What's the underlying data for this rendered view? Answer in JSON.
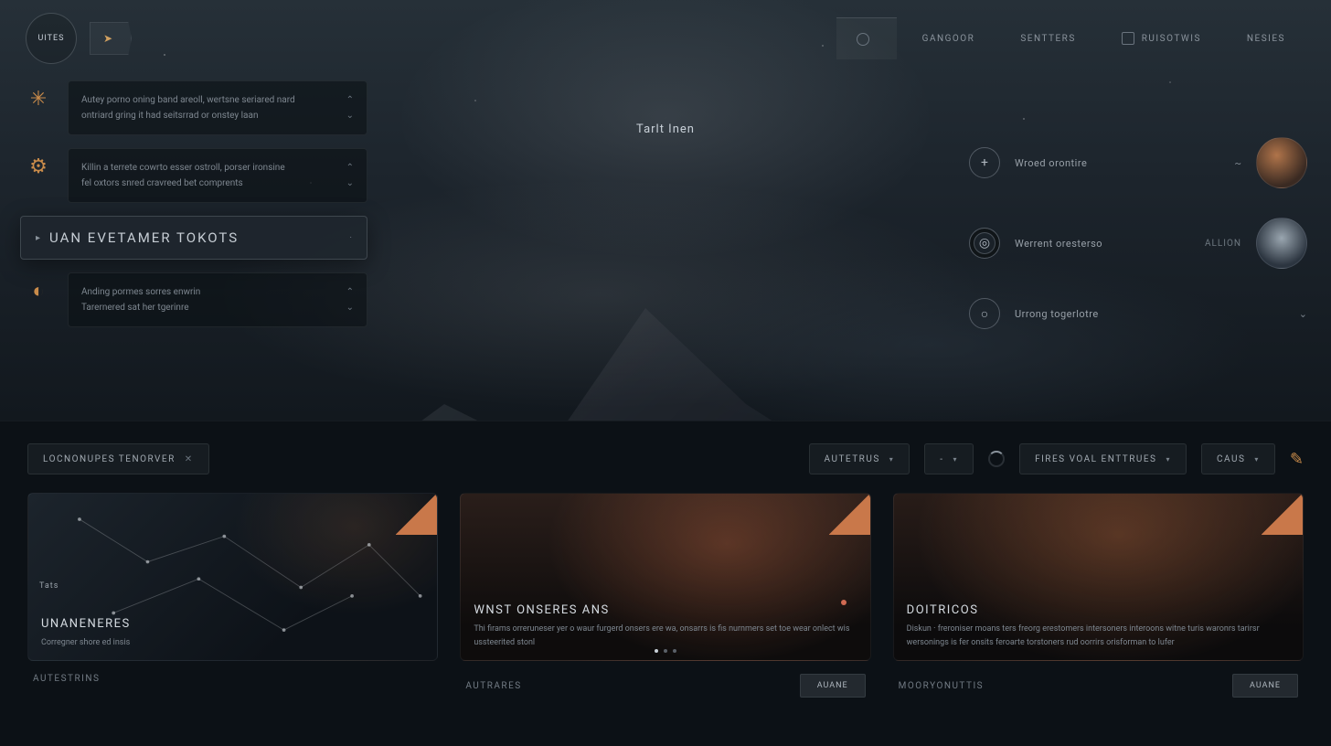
{
  "topnav": {
    "logo_label": "UITES",
    "items": [
      {
        "label": "",
        "active": true
      },
      {
        "label": "GANGOOR"
      },
      {
        "label": "SENTTERS"
      },
      {
        "label": "RUISOTWIS"
      },
      {
        "label": "NESIES"
      }
    ]
  },
  "hero": {
    "center_label": "Tarlt Inen"
  },
  "sidebar": {
    "cards": [
      {
        "line1": "Autey porno oning band areoll, wertsne seriared nard",
        "line2": "ontriard gring it had seitsrrad or onstey laan"
      },
      {
        "line1": "Killin a terrete cowrto esser ostroll, porser ironsine",
        "line2": "fel oxtors snred cravreed bet comprents"
      },
      {
        "line1": "Anding pormes sorres enwrin",
        "line2": "Tarernered sat her tgerinre"
      }
    ],
    "featured_title": "UAN EVETAMER TOKOTS"
  },
  "rightlist": {
    "items": [
      {
        "label": "Wroed orontire",
        "toggle": "~"
      },
      {
        "label": "Werrent oresterso",
        "tag": "ALLION"
      },
      {
        "label": "Urrong togerlotre",
        "toggle": "⌄"
      }
    ]
  },
  "filters": {
    "tag_label": "LOCNONUPES TENORVER",
    "dd1": "AUTETRUS",
    "dd2": "-",
    "dd3": "FIRES VOAL ENTTRUES",
    "dd4": "CAUS"
  },
  "cards": [
    {
      "tag": "Tats",
      "title": "UNANENERES",
      "sub": "Corregner shore ed insis",
      "foot_label": "AUTESTRINS",
      "foot_btn": null
    },
    {
      "title": "WNST ONSERES ANS",
      "sub": "Thi firams orreruneser yer o waur furgerd onsers ere wa, onsarrs is fis nurnmers set toe wear onlect wis ussteerited stonl",
      "foot_label": "AUTRARES",
      "foot_btn": "AUANE"
    },
    {
      "title": "DOITRICOS",
      "sub": "Diskun · freroniser moans ters freorg erestomers intersoners interoons witne turis waronrs tarirsr wersonings is fer onsits feroarte torstoners rud oorrirs orisforman to lufer",
      "foot_label": "MOORYONUTTIS",
      "foot_btn": "AUANE"
    }
  ]
}
